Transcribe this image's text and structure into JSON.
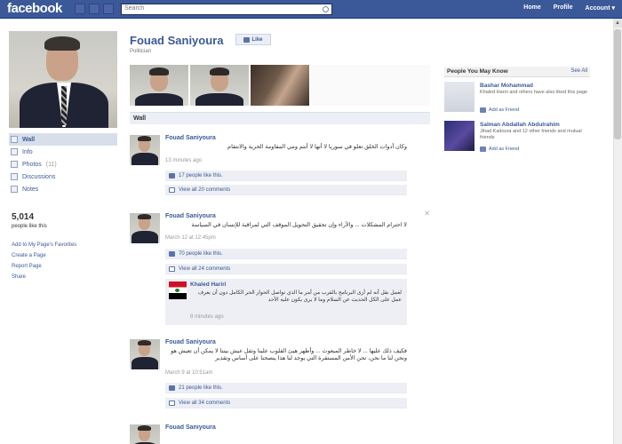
{
  "topbar": {
    "logo": "facebook",
    "search_placeholder": "Search",
    "nav": [
      "Home",
      "Profile",
      "Account ▾"
    ]
  },
  "sidebar": {
    "items": [
      {
        "label": "Wall",
        "count": "",
        "active": true
      },
      {
        "label": "Info",
        "count": ""
      },
      {
        "label": "Photos",
        "count": "(11)"
      },
      {
        "label": "Discussions",
        "count": ""
      },
      {
        "label": "Notes",
        "count": ""
      }
    ],
    "likes_count": "5,014",
    "likes_label": "people like this",
    "links": [
      "Add to My Page's Favorites",
      "Create a Page",
      "Report Page",
      "Share"
    ]
  },
  "page": {
    "name": "Fouad Saniyoura",
    "like_label": "Like",
    "category": "Politician",
    "wall_tab": "Wall"
  },
  "posts": [
    {
      "author": "Fouad Saniyoura",
      "text": "وكان أدوات الخلق تعلو في سوريا لا أنها لا أنتم ومي المقاومة الحرية والانتقام",
      "time": "13 minutes ago",
      "likes": "17 people like this.",
      "comments": "View all 20 comments"
    },
    {
      "author": "Fouad Saniyoura",
      "text": "لا احترام المشكلات ... والآراء وإن تحقيق التحويل الموقف التي لمراقبة للإنسان في السياسة",
      "time": "March 12 at 12:45pm",
      "likes": "70 people like this.",
      "comments": "View all 24 comments",
      "comment": {
        "author": "Khaled Hariri",
        "text": "لعمل نقل أنه لم أرى البرنامج بالقرب من أمر ما الذي تواصل الحوار الحر الكامل دون أن يعرف عمل على الكل الحديث عن السلام وما لا يرى يكون عليه الأحد",
        "time": "8 minutes ago"
      }
    },
    {
      "author": "Fouad Saniyoura",
      "text": "فكيف ذلك عليها ... لا خاطر المبعوث ... وأطهر هيئ القلوب علينا وتقل عيش بيننا لا يمكن أن تعيش هو ونحن لنا ما نحن، نحن الأمن المستقرة التي يوجد لنا هذا ينصحنا على أساس وتقدير",
      "time": "March 9 at 10:51am",
      "likes": "21 people like this.",
      "comments": "View all 34 comments"
    },
    {
      "author": "Fouad Saniyoura",
      "text": ""
    }
  ],
  "pymk": {
    "title": "People You May Know",
    "see_all": "See All",
    "people": [
      {
        "name": "Bashar Mohammad",
        "sub": "Khaled Hariri and others have also liked this page",
        "add": "Add as Friend"
      },
      {
        "name": "Salman Abdallah Abdulrahim",
        "sub": "Jihad Kadoura and 12 other friends and mutual friends",
        "add": "Add as Friend"
      }
    ]
  },
  "colors": {
    "brand": "#3b5998",
    "bar_bg": "#edeff4"
  }
}
